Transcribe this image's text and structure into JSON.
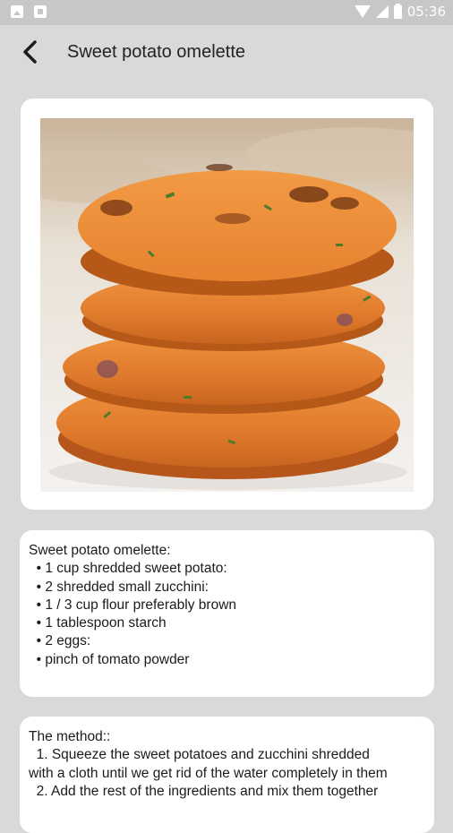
{
  "status_bar": {
    "time": "05:36",
    "icons": [
      "image-notification-icon",
      "photo-notification-icon",
      "wifi-icon",
      "cell-signal-icon",
      "battery-icon"
    ]
  },
  "app_bar": {
    "title": "Sweet potato omelette",
    "back_icon": "arrow-back-icon"
  },
  "ingredients": {
    "lines": [
      "Sweet potato omelette: ",
      "  • 1 cup shredded sweet potato:",
      "  • 2 shredded small zucchini:",
      "  • 1 / 3 cup flour preferably brown",
      "  • 1 tablespoon starch",
      "  • 2 eggs:",
      "  • pinch of tomato powder"
    ]
  },
  "method": {
    "lines": [
      "The method::",
      "  1. Squeeze the sweet potatoes and zucchini shredded",
      "with a cloth until we get rid of the water completely in them",
      "  2. Add the rest of the ingredients and mix them together"
    ]
  },
  "colors": {
    "background": "#d9d9d9",
    "status_bar": "#c7c7c7",
    "card": "#ffffff",
    "text": "#1b1b1b",
    "food_orange": "#e07a2c"
  }
}
